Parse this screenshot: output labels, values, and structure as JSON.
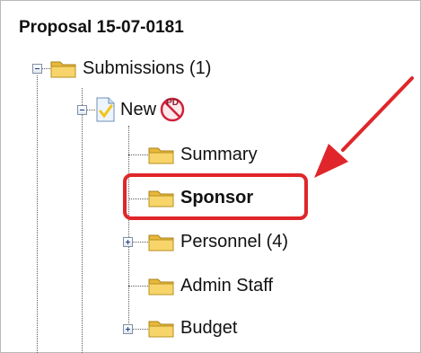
{
  "tree": {
    "title": "Proposal 15-07-0181",
    "nodes": [
      {
        "label": "Submissions (1)"
      },
      {
        "label": "New"
      },
      {
        "label": "Summary"
      },
      {
        "label": "Sponsor"
      },
      {
        "label": "Personnel (4)"
      },
      {
        "label": "Admin Staff"
      },
      {
        "label": "Budget"
      }
    ],
    "no_pd_badge": "PD"
  },
  "colors": {
    "highlight": "#e0262a",
    "arrow": "#e0262a",
    "folder": "#f2c84b"
  }
}
